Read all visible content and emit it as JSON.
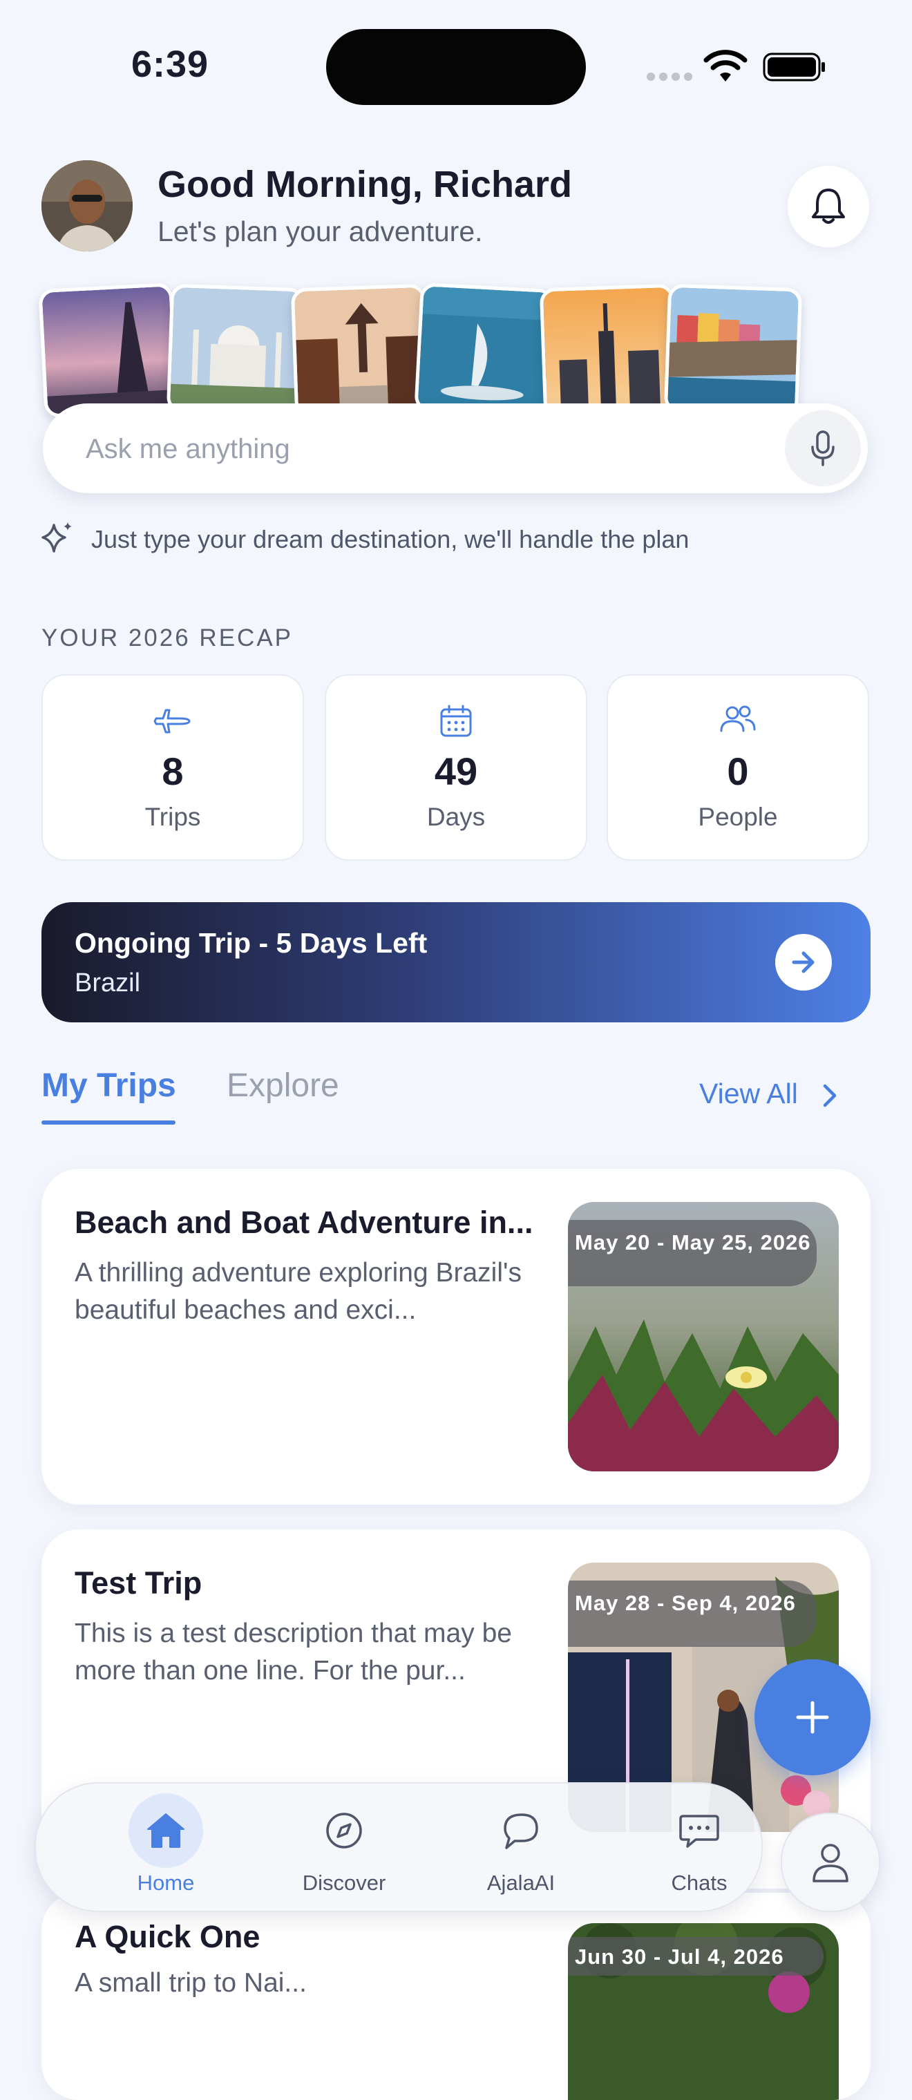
{
  "status_bar": {
    "time": "6:39"
  },
  "header": {
    "greeting": "Good Morning, Richard",
    "subtitle": "Let's plan your adventure."
  },
  "destinations": [
    "Eiffel Tower",
    "Taj Mahal",
    "Kyoto",
    "Burj Al Arab",
    "Empire State Building",
    "Cinque Terre"
  ],
  "search": {
    "placeholder": "Ask me anything",
    "hint": "Just type your dream destination, we'll handle the plan"
  },
  "recap": {
    "title": "YOUR 2026 RECAP",
    "stats": [
      {
        "value": "8",
        "label": "Trips",
        "icon": "airplane-icon"
      },
      {
        "value": "49",
        "label": "Days",
        "icon": "calendar-icon"
      },
      {
        "value": "0",
        "label": "People",
        "icon": "people-icon"
      }
    ]
  },
  "ongoing": {
    "title": "Ongoing Trip - 5 Days Left",
    "subtitle": "Brazil"
  },
  "tabs": {
    "my_trips": "My Trips",
    "explore": "Explore",
    "view_all": "View All"
  },
  "trips": [
    {
      "title": "Beach and Boat Adventure in...",
      "description": "A thrilling adventure exploring Brazil's beautiful beaches and exci...",
      "dates": "May 20 - May 25, 2026"
    },
    {
      "title": "Test Trip",
      "description": "This is a test description that may be more than one line. For the pur...",
      "dates": "May 28 - Sep 4, 2026"
    },
    {
      "title": "A Quick One",
      "description": "A small trip to Nai...",
      "dates": "Jun 30 - Jul 4, 2026"
    }
  ],
  "nav": {
    "items": [
      {
        "label": "Home",
        "icon": "home-icon",
        "active": true
      },
      {
        "label": "Discover",
        "icon": "compass-icon"
      },
      {
        "label": "AjalaAI",
        "icon": "ai-chat-icon"
      },
      {
        "label": "Chats",
        "icon": "chat-bubble-icon"
      }
    ]
  },
  "colors": {
    "accent": "#4a7fe2",
    "background": "#f3f6fc",
    "text": "#1b1b2e",
    "muted": "#5a5f70"
  }
}
